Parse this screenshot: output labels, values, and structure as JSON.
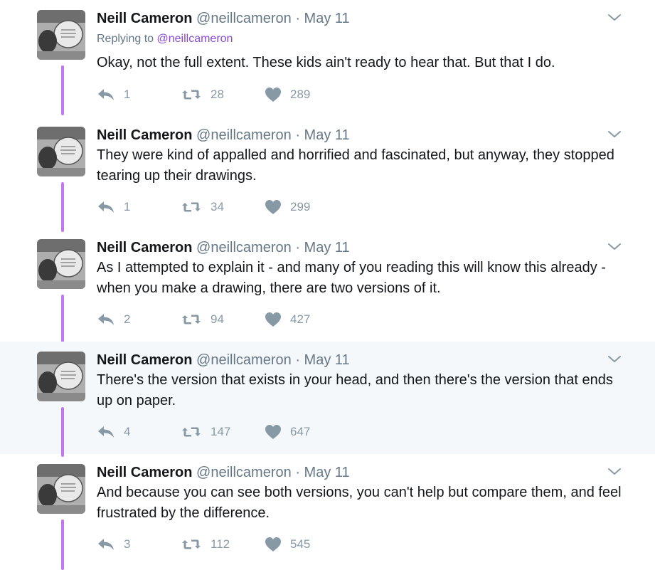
{
  "author": {
    "name": "Neill Cameron",
    "handle": "@neillcameron",
    "separator": "·"
  },
  "reply_context": {
    "label": "Replying to",
    "mention": "@neillcameron"
  },
  "tweets": [
    {
      "date": "May 11",
      "text": "Okay, not the full extent. These kids ain't ready to hear that. But that I do.",
      "replies": "1",
      "retweets": "28",
      "likes": "289"
    },
    {
      "date": "May 11",
      "text": "They were kind of appalled and horrified and fascinated, but anyway, they stopped tearing up their drawings.",
      "replies": "1",
      "retweets": "34",
      "likes": "299"
    },
    {
      "date": "May 11",
      "text": "As I attempted to explain it - and many of you reading this will know this already - when you make a drawing, there are two versions of it.",
      "replies": "2",
      "retweets": "94",
      "likes": "427"
    },
    {
      "date": "May 11",
      "text": "There's the version that exists in your head, and then there's the version that ends up on paper.",
      "replies": "4",
      "retweets": "147",
      "likes": "647"
    },
    {
      "date": "May 11",
      "text": "And because you can see both versions, you can't help but compare them, and feel frustrated by the difference.",
      "replies": "3",
      "retweets": "112",
      "likes": "545"
    }
  ],
  "colors": {
    "thread_line": "#c378f0",
    "highlight_background": "#f5f8fa",
    "mention": "#8b49d6",
    "muted_text": "#657786",
    "action_icons": "#8899a6"
  },
  "icons": {
    "reply": "reply-icon",
    "retweet": "retweet-icon",
    "like": "heart-icon",
    "menu": "chevron-down-icon"
  }
}
